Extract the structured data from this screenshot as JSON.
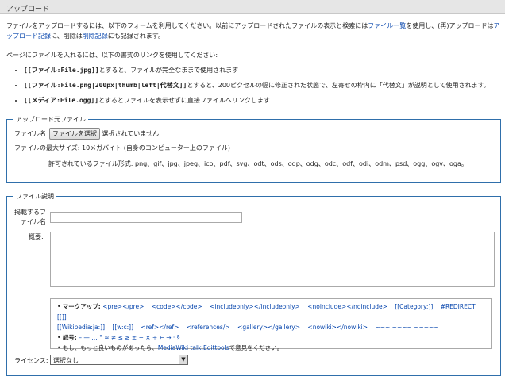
{
  "title": "アップロード",
  "intro": {
    "text1": "ファイルをアップロードするには、以下のフォームを利用してください。以前にアップロードされたファイルの表示と検索には",
    "link_filelist": "ファイル一覧",
    "text2": "を使用し、(再)アップロードは",
    "link_uploadlog": "アップロード記録",
    "text3": "に、削除は",
    "link_deletelog": "削除記録",
    "text4": "にも記録されます。",
    "para2": "ページにファイルを入れるには、以下の書式のリンクを使用してください:"
  },
  "syntax": [
    {
      "code": "[[ファイル:File.jpg]]",
      "desc": "とすると、ファイルが完全なままで使用されます"
    },
    {
      "code": "[[ファイル:File.png|200px|thumb|left|代替文]]",
      "desc": "とすると、200ピクセルの幅に修正された状態で、左寄せの枠内に「代替文」が説明として使用されます。"
    },
    {
      "code": "[[メディア:File.ogg]]",
      "desc": "とするとファイルを表示せずに直接ファイルへリンクします"
    }
  ],
  "source": {
    "legend": "アップロード元ファイル",
    "file_label": "ファイル名",
    "choose_button": "ファイルを選択",
    "no_file": "選択されていません",
    "max_size": "ファイルの最大サイズ: 10メガバイト (自身のコンピューター上のファイル)",
    "allowed": "許可されているファイル形式: png、gif、jpg、jpeg、ico、pdf、svg、odt、ods、odp、odg、odc、odf、odi、odm、psd、ogg、ogv、oga。"
  },
  "desc": {
    "legend": "ファイル説明",
    "dest_label_1": "掲載するフ",
    "dest_label_2": "ァイル名",
    "summary_label": "概要:",
    "markup_label": "マークアップ:",
    "markup_items": [
      "<pre></pre>",
      "<code></code>",
      "<includeonly></includeonly>",
      "<noinclude></noinclude>",
      "[[Category:]]",
      "#REDIRECT [[]]"
    ],
    "markup_items2": [
      "[[Wikipedia:ja:]]",
      "[[w:c:]]",
      "<ref></ref>",
      "<references/>",
      "<gallery></gallery>",
      "<nowiki></nowiki>",
      "~~~ ~~~~ ~~~~~"
    ],
    "symbols_label": "記号:",
    "symbols": "– — … ° ≈ ≠ ≤ ≥ ± − × ÷ ← → · §",
    "more_text1": "もし、もっと良いものがあったら、",
    "more_link": "MediaWiki talk:Edittools",
    "more_text2": "で意見をください。",
    "license_label": "ライセンス:",
    "license_value": "選択なし"
  }
}
